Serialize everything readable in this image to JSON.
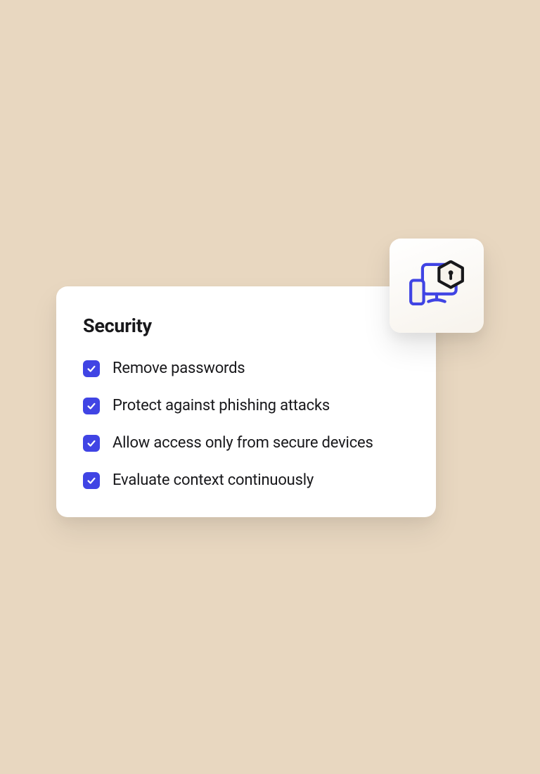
{
  "card": {
    "title": "Security",
    "items": [
      {
        "label": "Remove passwords",
        "checked": true
      },
      {
        "label": "Protect against phishing attacks",
        "checked": true
      },
      {
        "label": "Allow access only from secure devices",
        "checked": true
      },
      {
        "label": "Evaluate context continuously",
        "checked": true
      }
    ]
  },
  "colors": {
    "accent": "#4044e4",
    "background": "#e8d7c0",
    "card": "#ffffff",
    "text": "#18181b"
  },
  "icon": {
    "name": "secure-devices-icon"
  }
}
